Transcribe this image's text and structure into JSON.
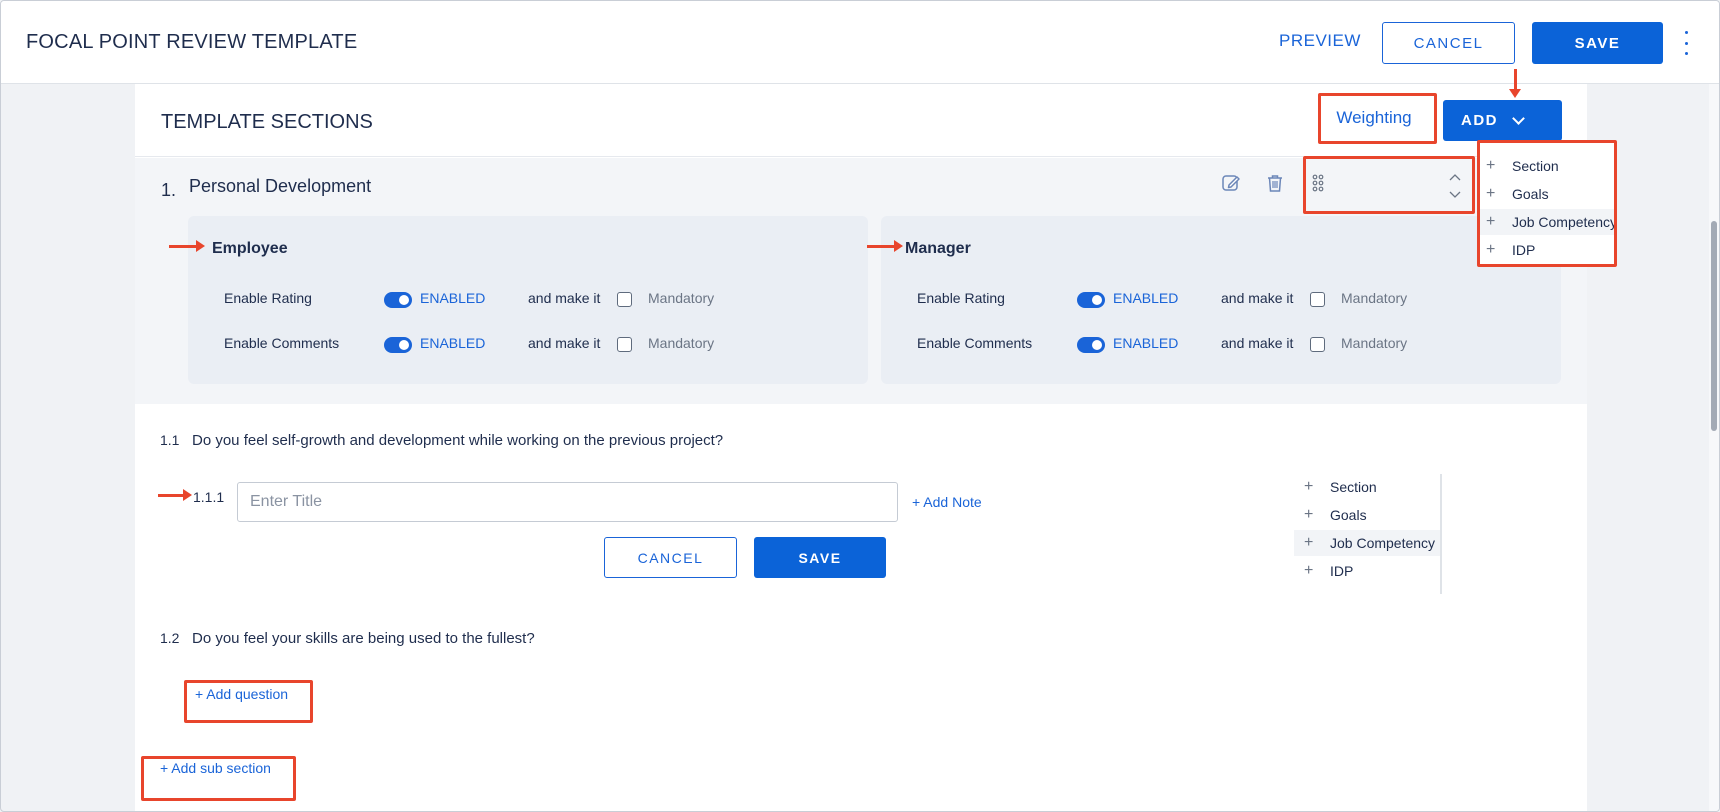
{
  "header": {
    "title": "FOCAL POINT REVIEW TEMPLATE",
    "preview_label": "PREVIEW",
    "cancel_label": "CANCEL",
    "save_label": "SAVE"
  },
  "template": {
    "title": "TEMPLATE SECTIONS",
    "weighting_label": "Weighting",
    "add_label": "ADD",
    "add_menu": [
      "Section",
      "Goals",
      "Job Competency",
      "IDP"
    ]
  },
  "section": {
    "number": "1.",
    "name": "Personal Development",
    "employee": {
      "title": "Employee",
      "rows": [
        {
          "label": "Enable Rating",
          "status": "ENABLED",
          "connector": "and make it",
          "checkbox_label": "Mandatory"
        },
        {
          "label": "Enable Comments",
          "status": "ENABLED",
          "connector": "and make it",
          "checkbox_label": "Mandatory"
        }
      ]
    },
    "manager": {
      "title": "Manager",
      "rows": [
        {
          "label": "Enable Rating",
          "status": "ENABLED",
          "connector": "and make it",
          "checkbox_label": "Mandatory"
        },
        {
          "label": "Enable Comments",
          "status": "ENABLED",
          "connector": "and make it",
          "checkbox_label": "Mandatory"
        }
      ]
    }
  },
  "questions": [
    {
      "number": "1.1",
      "text": "Do you feel self-growth and development while working on the previous project?"
    },
    {
      "number": "1.2",
      "text": "Do you feel your skills are being used to the fullest?"
    }
  ],
  "sub_question": {
    "number": "1.1.1",
    "placeholder": "Enter Title",
    "add_note_label": "+ Add Note",
    "cancel_label": "CANCEL",
    "save_label": "SAVE"
  },
  "side_menu": [
    "Section",
    "Goals",
    "Job Competency",
    "IDP"
  ],
  "add_question_label": "+ Add question",
  "add_subsection_label": "+ Add sub section",
  "colors": {
    "primary": "#0b63d8",
    "annotation": "#e8452c",
    "text": "#1f2d4d"
  }
}
